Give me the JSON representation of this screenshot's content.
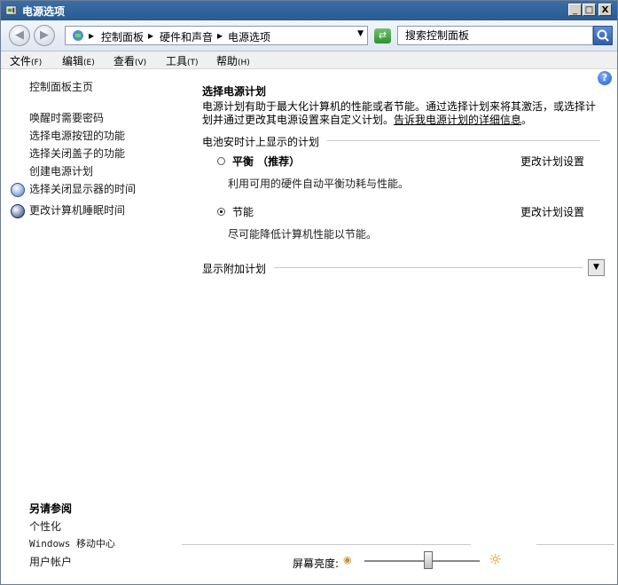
{
  "window": {
    "title": "电源选项",
    "min_label": "_",
    "max_label": "□",
    "close_label": "X"
  },
  "address": {
    "crumbs": [
      "控制面板",
      "硬件和声音",
      "电源选项"
    ],
    "search_placeholder": "搜索控制面板"
  },
  "menu": [
    {
      "label": "文件",
      "key": "(F)"
    },
    {
      "label": "编辑",
      "key": "(E)"
    },
    {
      "label": "查看",
      "key": "(V)"
    },
    {
      "label": "工具",
      "key": "(T)"
    },
    {
      "label": "帮助",
      "key": "(H)"
    }
  ],
  "sidebar": {
    "home": "控制面板主页",
    "items": [
      "唤醒时需要密码",
      "选择电源按钮的功能",
      "选择关闭盖子的功能",
      "创建电源计划",
      "选择关闭显示器的时间",
      "更改计算机睡眠时间"
    ],
    "see_also_title": "另请参阅",
    "see_also": [
      "个性化",
      "Windows 移动中心",
      "用户帐户"
    ]
  },
  "main": {
    "heading": "选择电源计划",
    "desc_line1": "电源计划有助于最大化计算机的性能或者节能。通过选择计划来将其激活，或选择计",
    "desc_line2": "划并通过更改其电源设置来自定义计划。",
    "desc_link": "告诉我电源计划的详细信息",
    "desc_end": "。",
    "battery_section": "电池安时计上显示的计划",
    "plans": [
      {
        "name": "平衡 （推荐）",
        "desc": "利用可用的硬件自动平衡功耗与性能。",
        "change": "更改计划设置",
        "selected": false
      },
      {
        "name": "节能",
        "desc": "尽可能降低计算机性能以节能。",
        "change": "更改计划设置",
        "selected": true
      }
    ],
    "extra_section": "显示附加计划"
  },
  "brightness": {
    "label": "屏幕亮度:",
    "level": 0.55
  },
  "colors": {
    "titlebar": "#2a5a92",
    "link": "#000000"
  }
}
